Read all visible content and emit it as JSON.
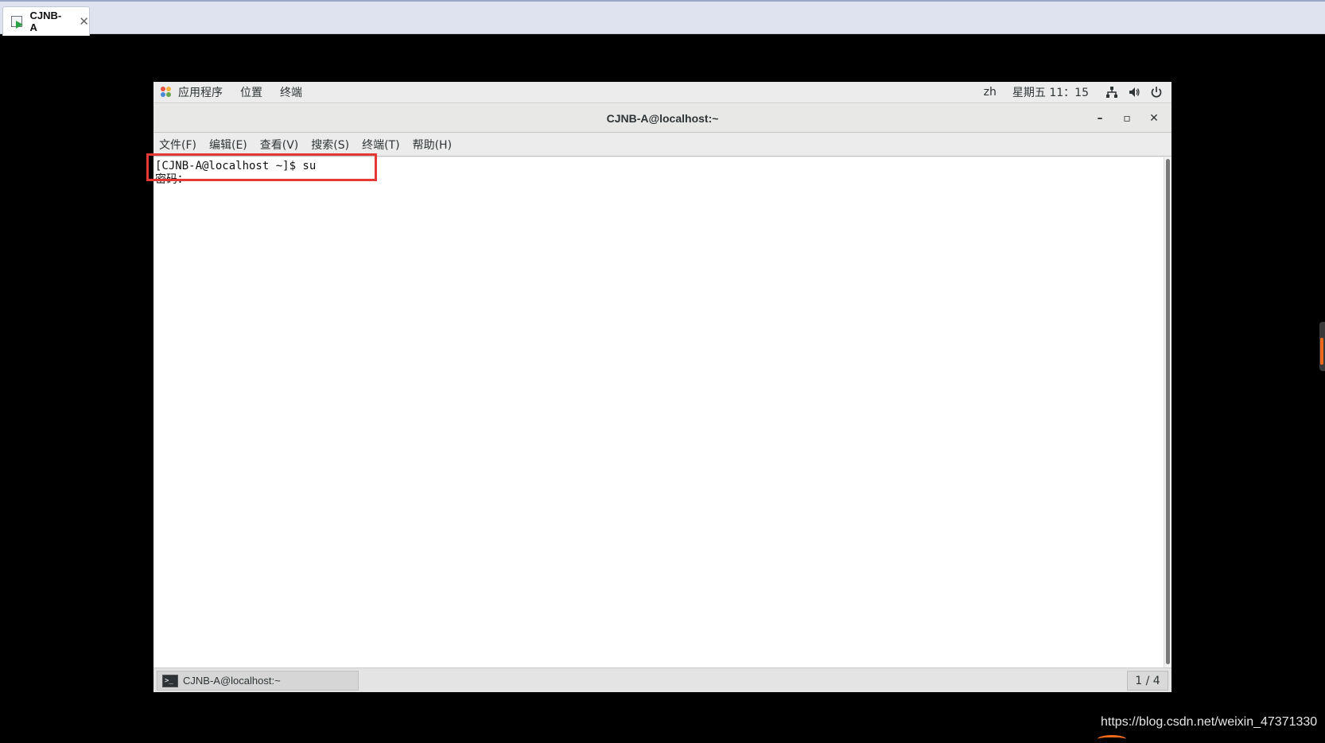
{
  "host": {
    "tab_label": "CJNB-A",
    "tab_close": "✕"
  },
  "gnome_bar": {
    "menus": [
      "应用程序",
      "位置",
      "终端"
    ],
    "lang": "zh",
    "clock": "星期五 11：15"
  },
  "window": {
    "title": "CJNB-A@localhost:~",
    "minimize": "–",
    "maximize": "▫",
    "close": "✕"
  },
  "menubar": {
    "items": [
      "文件(F)",
      "编辑(E)",
      "查看(V)",
      "搜索(S)",
      "终端(T)",
      "帮助(H)"
    ]
  },
  "terminal": {
    "lines": [
      "[CJNB-A@localhost ~]$ su",
      "密码："
    ]
  },
  "taskbar": {
    "task_label": "CJNB-A@localhost:~",
    "pager": "1 / 4"
  },
  "watermark": "https://blog.csdn.net/weixin_47371330",
  "colors": {
    "highlight": "#e53935",
    "accent_orange": "#f06a1c"
  }
}
